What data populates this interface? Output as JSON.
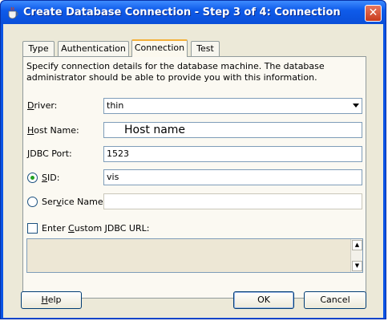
{
  "window": {
    "title": "Create Database Connection - Step 3 of 4: Connection",
    "close_icon": "close-icon",
    "app_icon": "database-cup-icon"
  },
  "tabs": [
    {
      "label": "Type"
    },
    {
      "label": "Authentication"
    },
    {
      "label": "Connection",
      "active": true
    },
    {
      "label": "Test"
    }
  ],
  "intro": "Specify connection details for the database machine. The database administrator should be able to provide you with this information.",
  "form": {
    "driver": {
      "label_pre": "",
      "label_key": "D",
      "label_post": "river:",
      "value": "thin"
    },
    "host": {
      "label_pre": "",
      "label_key": "H",
      "label_post": "ost Name:",
      "value": "Host name"
    },
    "port": {
      "label_pre": "",
      "label_key": "J",
      "label_post": "DBC Port:",
      "value": "1523"
    },
    "sid": {
      "label_pre": "",
      "label_key": "S",
      "label_post": "ID:",
      "value": "vis",
      "selected": true
    },
    "service": {
      "label_pre": "Ser",
      "label_key": "v",
      "label_post": "ice Name:",
      "value": ""
    },
    "custom_url": {
      "label_pre": "Enter ",
      "label_key": "C",
      "label_post": "ustom JDBC URL:",
      "checked": false
    }
  },
  "buttons": {
    "help": {
      "pre": "",
      "key": "H",
      "post": "elp"
    },
    "ok": "OK",
    "cancel": "Cancel"
  }
}
